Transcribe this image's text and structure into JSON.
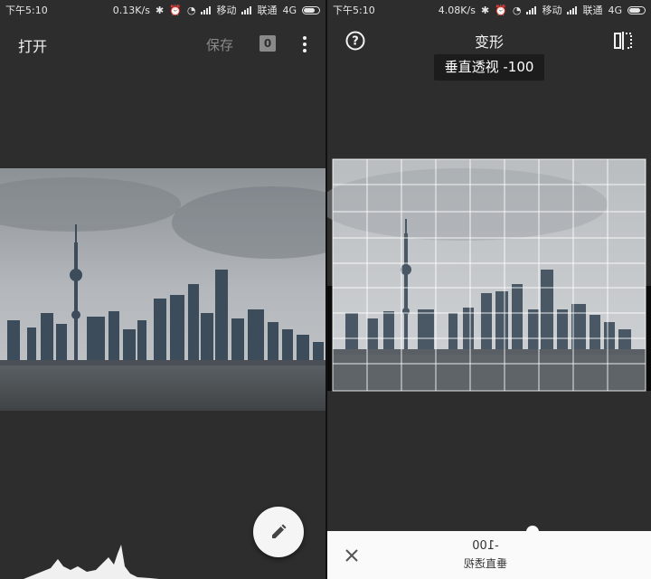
{
  "left_panel": {
    "status": {
      "time": "下午5:10",
      "speed": "0.13K/s",
      "carrier1": "移动",
      "carrier2": "联通",
      "network": "4G"
    },
    "toolbar": {
      "open_label": "打开",
      "save_label": "保存",
      "badge_count": "0",
      "more_icon": "more-vert-icon"
    },
    "fab_icon": "pencil-icon"
  },
  "right_panel": {
    "status": {
      "time": "下午5:10",
      "speed": "4.08K/s",
      "carrier1": "移动",
      "carrier2": "联通",
      "network": "4G"
    },
    "toolbar": {
      "title": "变形",
      "help_icon": "help-icon",
      "compare_icon": "compare-icon"
    },
    "tooltip": "垂直透视 -100",
    "bottom_sheet": {
      "value": "-100",
      "param_name": "垂直透视",
      "close_icon": "close-icon"
    }
  },
  "colors": {
    "app_bg": "#2d2d2d",
    "sheet_bg": "#fafafa",
    "muted": "#8a8a8a"
  }
}
